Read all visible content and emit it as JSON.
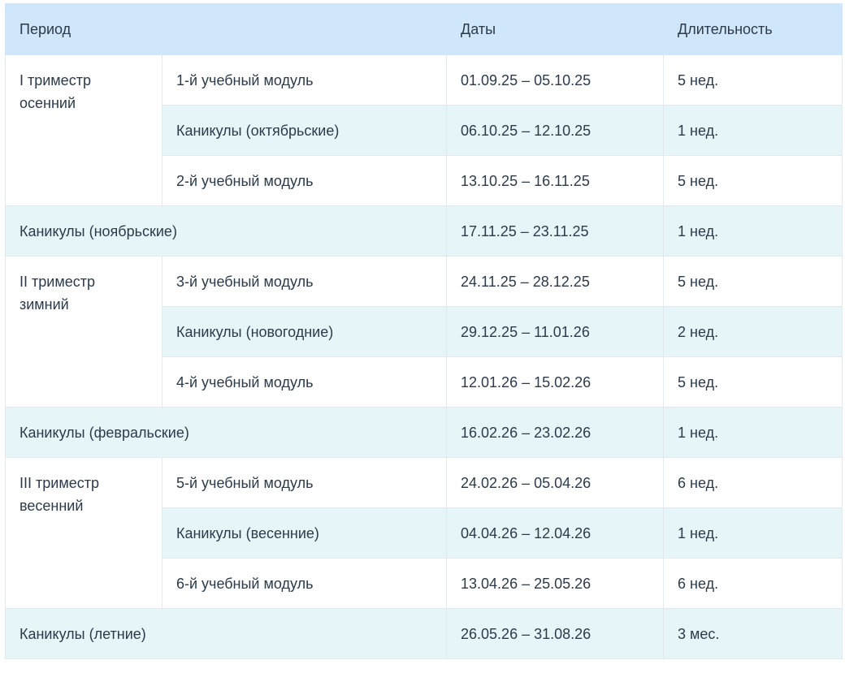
{
  "header": {
    "period": "Период",
    "dates": "Даты",
    "duration": "Длительность"
  },
  "groups": [
    {
      "period_line1": "I триместр",
      "period_line2": "осенний",
      "rows": [
        {
          "name": "1-й учебный модуль",
          "dates": "01.09.25 – 05.10.25",
          "duration": "5 нед."
        },
        {
          "name": "Каникулы (октябрьские)",
          "dates": "06.10.25 – 12.10.25",
          "duration": "1 нед."
        },
        {
          "name": "2-й учебный модуль",
          "dates": "13.10.25 – 16.11.25",
          "duration": "5 нед."
        }
      ]
    },
    {
      "period_line1": "II триместр",
      "period_line2": "зимний",
      "rows": [
        {
          "name": "3-й учебный модуль",
          "dates": "24.11.25 – 28.12.25",
          "duration": "5 нед."
        },
        {
          "name": "Каникулы (новогодние)",
          "dates": "29.12.25 – 11.01.26",
          "duration": "2 нед."
        },
        {
          "name": "4-й учебный модуль",
          "dates": "12.01.26 – 15.02.26",
          "duration": "5 нед."
        }
      ]
    },
    {
      "period_line1": "III триместр",
      "period_line2": "весенний",
      "rows": [
        {
          "name": "5-й учебный модуль",
          "dates": "24.02.26 – 05.04.26",
          "duration": "6 нед."
        },
        {
          "name": "Каникулы (весенние)",
          "dates": "04.04.26 – 12.04.26",
          "duration": "1 нед."
        },
        {
          "name": "6-й учебный модуль",
          "dates": "13.04.26 – 25.05.26",
          "duration": "6 нед."
        }
      ]
    }
  ],
  "breaks": [
    {
      "name": "Каникулы (ноябрьские)",
      "dates": "17.11.25 – 23.11.25",
      "duration": "1 нед."
    },
    {
      "name": "Каникулы (февральские)",
      "dates": "16.02.26 – 23.02.26",
      "duration": "1 нед."
    },
    {
      "name": "Каникулы (летние)",
      "dates": "26.05.26 – 31.08.26",
      "duration": "3 мес."
    }
  ],
  "colors": {
    "header_bg": "#cfe6fb",
    "vacation_row_bg": "#e6f6f8",
    "border": "#e3e8ee",
    "text": "#2c3a4a"
  }
}
